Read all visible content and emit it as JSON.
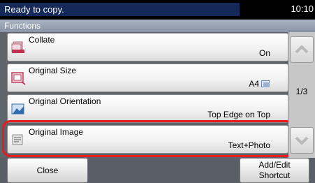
{
  "status": {
    "message": "Ready to copy.",
    "time": "10:10"
  },
  "title": "Functions",
  "functions": [
    {
      "label": "Collate",
      "value": "On",
      "icon": "collate-icon"
    },
    {
      "label": "Original Size",
      "value": "A4",
      "icon": "original-size-icon",
      "value_icon": "paper-size-icon"
    },
    {
      "label": "Original Orientation",
      "value": "Top Edge on Top",
      "icon": "original-orientation-icon"
    },
    {
      "label": "Original Image",
      "value": "Text+Photo",
      "icon": "original-image-icon",
      "highlighted": true
    }
  ],
  "scroll": {
    "page_indicator": "1/3",
    "up_icon": "chevron-up-icon",
    "down_icon": "chevron-down-icon"
  },
  "footer": {
    "close_label": "Close",
    "shortcut_line1": "Add/Edit",
    "shortcut_line2": "Shortcut"
  },
  "colors": {
    "highlight": "#e8191f",
    "status_bg": "#14285a"
  }
}
